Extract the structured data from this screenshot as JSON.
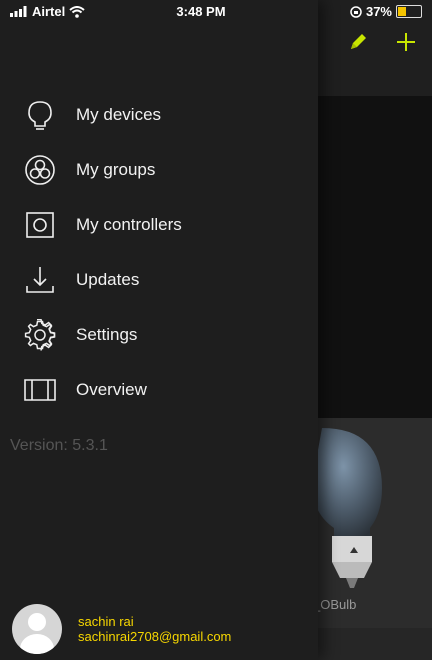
{
  "status_bar": {
    "carrier": "Airtel",
    "time": "3:48 PM",
    "battery": "37%",
    "battery_level": 0.37
  },
  "header": {
    "edit_icon": "pencil-icon",
    "add_icon": "plus-icon",
    "accent_color": "#c8e600"
  },
  "drawer": {
    "items": [
      {
        "label": "My devices",
        "icon": "bulb-icon"
      },
      {
        "label": "My groups",
        "icon": "group-icon"
      },
      {
        "label": "My controllers",
        "icon": "controller-icon"
      },
      {
        "label": "Updates",
        "icon": "download-icon"
      },
      {
        "label": "Settings",
        "icon": "gear-icon"
      },
      {
        "label": "Overview",
        "icon": "map-icon"
      }
    ],
    "version": "Version: 5.3.1"
  },
  "profile": {
    "name": "sachin rai",
    "email": "sachinrai2708@gmail.com",
    "text_color": "#f7d700"
  },
  "background": {
    "card_label": "_OBulb"
  }
}
